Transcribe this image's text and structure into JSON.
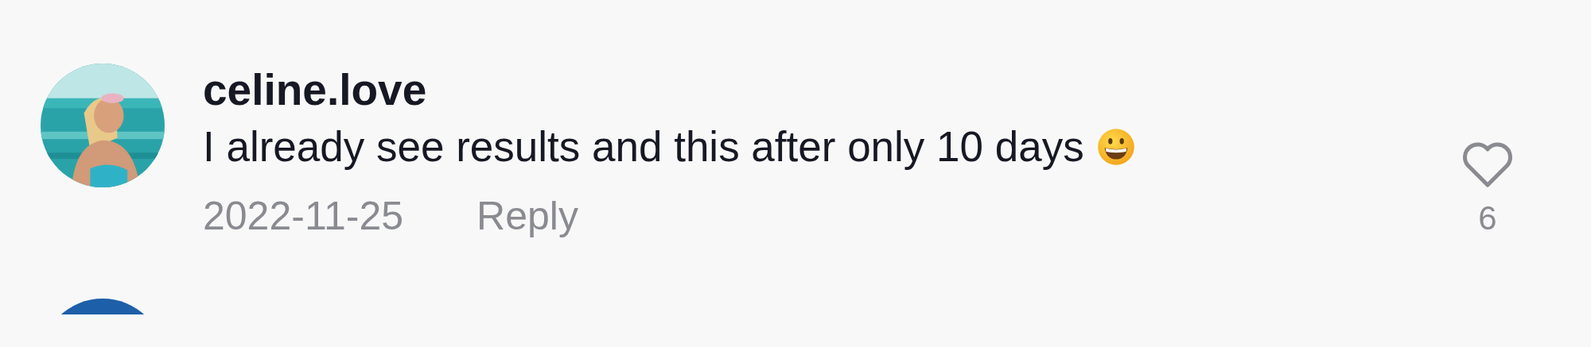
{
  "comment": {
    "username": "celine.love",
    "text": "I already see results and this after only 10 days",
    "date": "2022-11-25",
    "reply": "Reply",
    "likes": "6",
    "liked": false
  }
}
